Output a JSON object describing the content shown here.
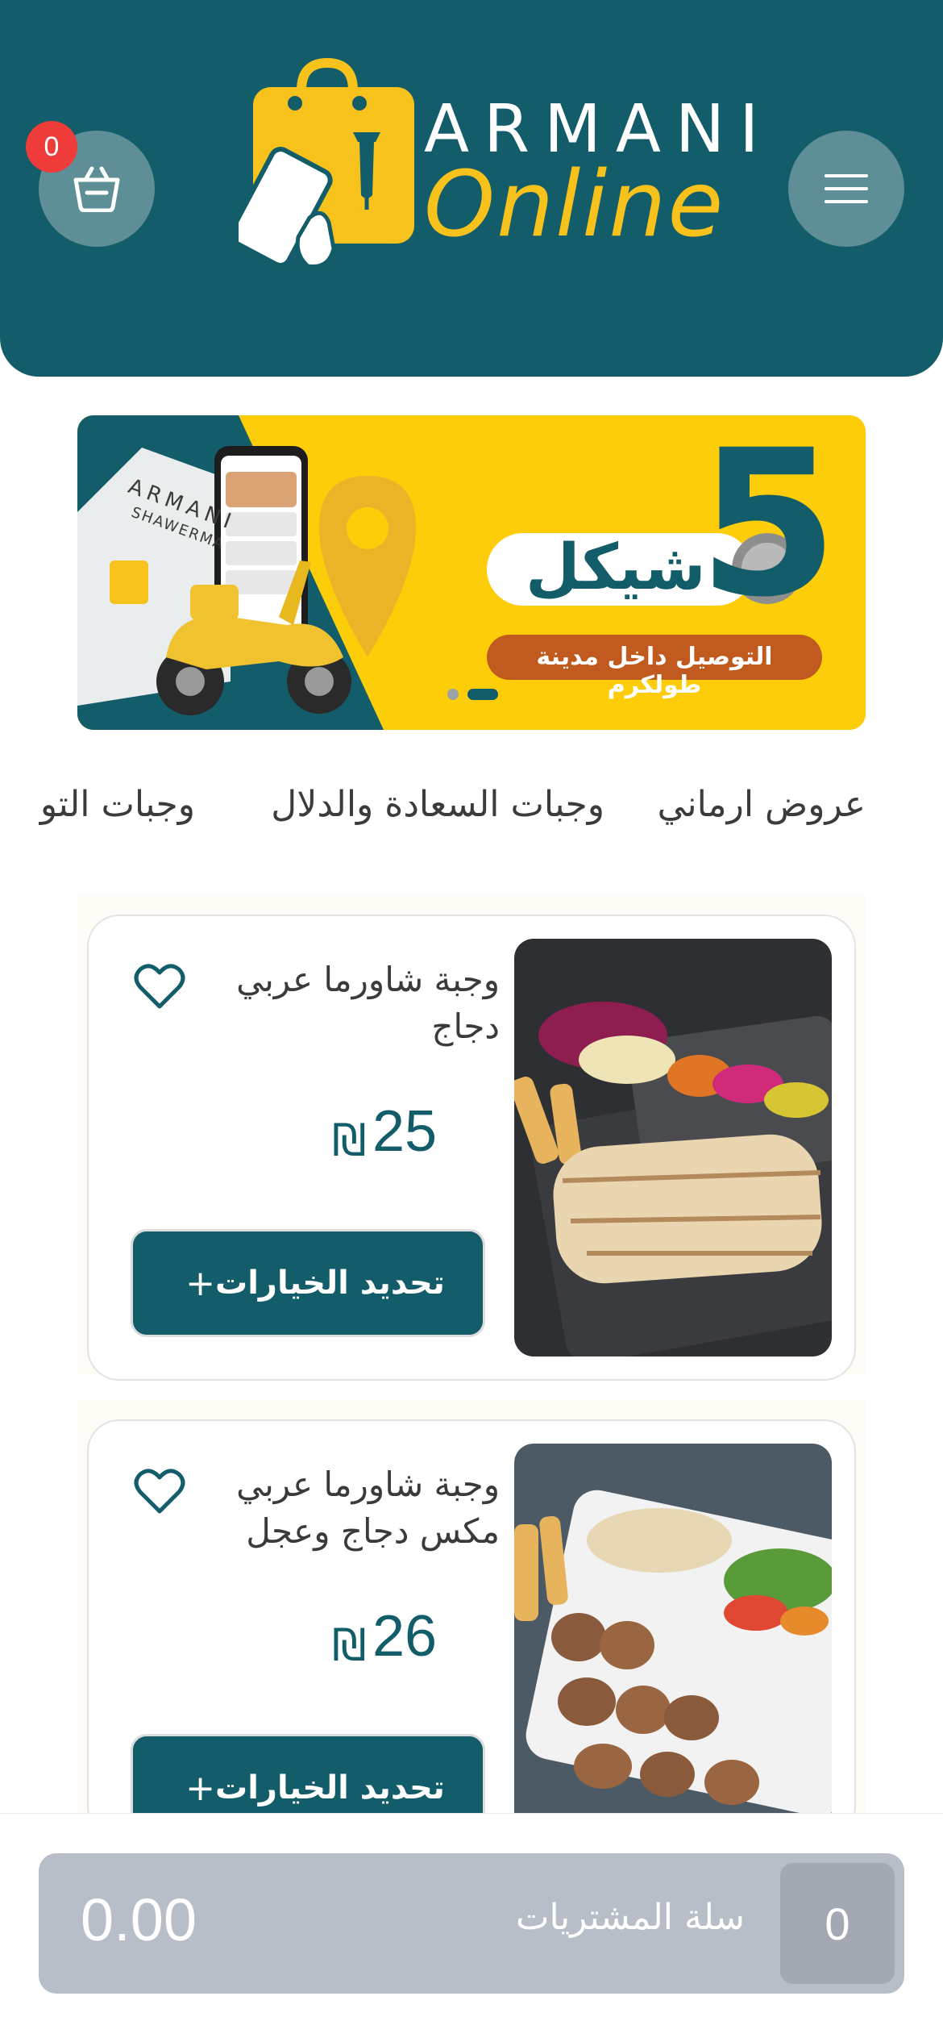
{
  "header": {
    "cart_count": "0",
    "logo_line1": "ARMANI",
    "logo_line2": "Online",
    "cart_icon": "basket-icon",
    "menu_icon": "hamburger-icon"
  },
  "banner": {
    "price_number": "5",
    "price_word": "شيكل",
    "delivery_text": "التوصيل داخل مدينة طولكرم",
    "box_brand": "ARMANI",
    "box_sub": "SHAWERMA",
    "slides": 2,
    "active_slide": 1
  },
  "categories": [
    "عروض ارماني",
    "وجبات السعادة والدلال",
    "وجبات التو"
  ],
  "products": [
    {
      "title": "وجبة شاورما عربي دجاج",
      "price": "25",
      "currency": "₪",
      "button": "تحديد الخيارات",
      "button_plus": "+"
    },
    {
      "title": "وجبة شاورما عربي مكس دجاج وعجل",
      "price": "26",
      "currency": "₪",
      "button": "تحديد الخيارات",
      "button_plus": "+"
    }
  ],
  "basket": {
    "total": "0.00",
    "label": "سلة المشتريات",
    "count": "0"
  },
  "colors": {
    "primary": "#135c69",
    "accent": "#fecd0a",
    "badge": "#ef3c3a",
    "basket_bar": "#b8bec8"
  }
}
